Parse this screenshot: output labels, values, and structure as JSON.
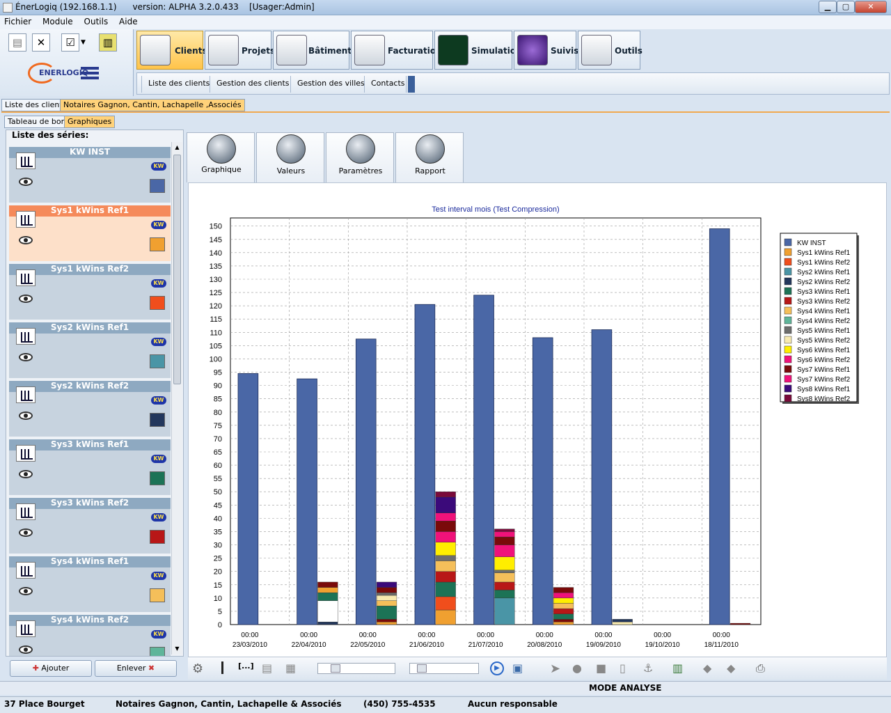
{
  "window": {
    "title": "ÉnerLogiq (192.168.1.1)      version: ALPHA 3.2.0.433    [Usager:Admin]"
  },
  "menu": [
    "Fichier",
    "Module",
    "Outils",
    "Aide"
  ],
  "logo": "ENERLOGIQ",
  "modules": [
    {
      "label": "Clients",
      "active": true
    },
    {
      "label": "Projets"
    },
    {
      "label": "Bâtiments"
    },
    {
      "label": "Facturation"
    },
    {
      "label": "Simulation"
    },
    {
      "label": "Suivis"
    },
    {
      "label": "Outils"
    }
  ],
  "submenu": [
    "Liste des clients",
    "Gestion des clients",
    "Gestion des villes",
    "Contacts"
  ],
  "doctabs": [
    "Liste des clients",
    "Notaires Gagnon, Cantin, Lachapelle ,Associés"
  ],
  "subtabs": [
    "Tableau de bord",
    "Graphiques"
  ],
  "series_panel_title": "Liste des séries:",
  "series": [
    {
      "name": "KW INST",
      "color": "#4a67a6",
      "badge": "KW",
      "selected": false
    },
    {
      "name": "Sys1 kWins Ref1",
      "color": "#f0a030",
      "badge": "KW",
      "selected": true
    },
    {
      "name": "Sys1 kWins Ref2",
      "color": "#f04e1c",
      "badge": "KW",
      "selected": false
    },
    {
      "name": "Sys2 kWins Ref1",
      "color": "#4a95a6",
      "badge": "KW",
      "selected": false
    },
    {
      "name": "Sys2 kWins Ref2",
      "color": "#23375c",
      "badge": "KW",
      "selected": false
    },
    {
      "name": "Sys3 kWins Ref1",
      "color": "#1c7356",
      "badge": "KW",
      "selected": false
    },
    {
      "name": "Sys3 kWins Ref2",
      "color": "#b81717",
      "badge": "KW",
      "selected": false
    },
    {
      "name": "Sys4 kWins Ref1",
      "color": "#f5bf5a",
      "badge": "KW",
      "selected": false
    },
    {
      "name": "Sys4 kWins Ref2",
      "color": "#5fb59a",
      "badge": "KW",
      "selected": false
    }
  ],
  "buttons": {
    "add": "Ajouter",
    "remove": "Enlever"
  },
  "graph_tabs": [
    "Graphique",
    "Valeurs",
    "Paramètres",
    "Rapport"
  ],
  "mode": "MODE ANALYSE",
  "status": [
    "37 Place Bourget",
    "Notaires Gagnon, Cantin, Lachapelle & Associés",
    "(450) 755-4535",
    "Aucun responsable"
  ],
  "chart_data": {
    "type": "bar",
    "title": "Test interval mois (Test Compression)",
    "ylim": [
      0,
      150
    ],
    "ytick_step": 5,
    "grid": true,
    "legend_position": "right",
    "categories": [
      "00:00\n23/03/2010",
      "00:00\n22/04/2010",
      "00:00\n22/05/2010",
      "00:00\n21/06/2010",
      "00:00\n21/07/2010",
      "00:00\n20/08/2010",
      "00:00\n19/09/2010",
      "00:00\n19/10/2010",
      "00:00\n18/11/2010"
    ],
    "legend": [
      {
        "name": "KW INST",
        "color": "#4a67a6"
      },
      {
        "name": "Sys1 kWins Ref1",
        "color": "#f0a030"
      },
      {
        "name": "Sys1 kWins Ref2",
        "color": "#f04e1c"
      },
      {
        "name": "Sys2 kWins Ref1",
        "color": "#4a95a6"
      },
      {
        "name": "Sys2 kWins Ref2",
        "color": "#23375c"
      },
      {
        "name": "Sys3 kWins Ref1",
        "color": "#1c7356"
      },
      {
        "name": "Sys3 kWins Ref2",
        "color": "#b81717"
      },
      {
        "name": "Sys4 kWins Ref1",
        "color": "#f5bf5a"
      },
      {
        "name": "Sys4 kWins Ref2",
        "color": "#5fb59a"
      },
      {
        "name": "Sys5 kWins Ref1",
        "color": "#6d6d6d"
      },
      {
        "name": "Sys5 kWins Ref2",
        "color": "#f8eab0"
      },
      {
        "name": "Sys6 kWins Ref1",
        "color": "#ffee00"
      },
      {
        "name": "Sys6 kWins Ref2",
        "color": "#f0127a"
      },
      {
        "name": "Sys7 kWins Ref1",
        "color": "#7a0a0a"
      },
      {
        "name": "Sys7 kWins Ref2",
        "color": "#f0127a"
      },
      {
        "name": "Sys8 kWins Ref1",
        "color": "#3b0a7a"
      },
      {
        "name": "Sys8 kWins Ref2",
        "color": "#7a0a3a"
      }
    ],
    "kw_inst": [
      94.5,
      92.5,
      107.5,
      120.5,
      124,
      108,
      111,
      0,
      149
    ],
    "stacks": [
      [],
      [
        [
          1,
          "#23375c"
        ],
        [
          8,
          "#ffffff"
        ],
        [
          3,
          "#1c7356"
        ],
        [
          2,
          "#f0a030"
        ],
        [
          2,
          "#7a0a0a"
        ]
      ],
      [
        [
          1,
          "#f0a030"
        ],
        [
          1,
          "#7a0a0a"
        ],
        [
          5,
          "#1c7356"
        ],
        [
          2,
          "#f5bf5a"
        ],
        [
          2,
          "#f8eab0"
        ],
        [
          1,
          "#6d6d6d"
        ],
        [
          2,
          "#7a0a0a"
        ],
        [
          2,
          "#3b0a7a"
        ]
      ],
      [
        [
          5.5,
          "#f0a030"
        ],
        [
          5,
          "#f04e1c"
        ],
        [
          5.5,
          "#1c7356"
        ],
        [
          4,
          "#b81717"
        ],
        [
          4,
          "#f5bf5a"
        ],
        [
          2,
          "#6d6d6d"
        ],
        [
          5,
          "#ffee00"
        ],
        [
          4,
          "#f0127a"
        ],
        [
          4,
          "#7a0a0a"
        ],
        [
          3,
          "#f0127a"
        ],
        [
          6,
          "#3b0a7a"
        ],
        [
          2,
          "#7a0a3a"
        ]
      ],
      [
        [
          10,
          "#4a95a6"
        ],
        [
          3,
          "#1c7356"
        ],
        [
          3,
          "#b81717"
        ],
        [
          3.5,
          "#f5bf5a"
        ],
        [
          1,
          "#6d6d6d"
        ],
        [
          5,
          "#ffee00"
        ],
        [
          4.5,
          "#f0127a"
        ],
        [
          3,
          "#7a0a0a"
        ],
        [
          2,
          "#f0127a"
        ],
        [
          1,
          "#7a0a3a"
        ]
      ],
      [
        [
          1,
          "#f0a030"
        ],
        [
          1,
          "#7a0a0a"
        ],
        [
          2,
          "#1c7356"
        ],
        [
          2,
          "#b81717"
        ],
        [
          2,
          "#f5bf5a"
        ],
        [
          2,
          "#ffee00"
        ],
        [
          2,
          "#f0127a"
        ],
        [
          2,
          "#7a0a0a"
        ]
      ],
      [
        [
          1,
          "#f8eab0"
        ],
        [
          1,
          "#23375c"
        ]
      ],
      [],
      [
        [
          0.5,
          "#7a0a0a"
        ]
      ]
    ]
  }
}
